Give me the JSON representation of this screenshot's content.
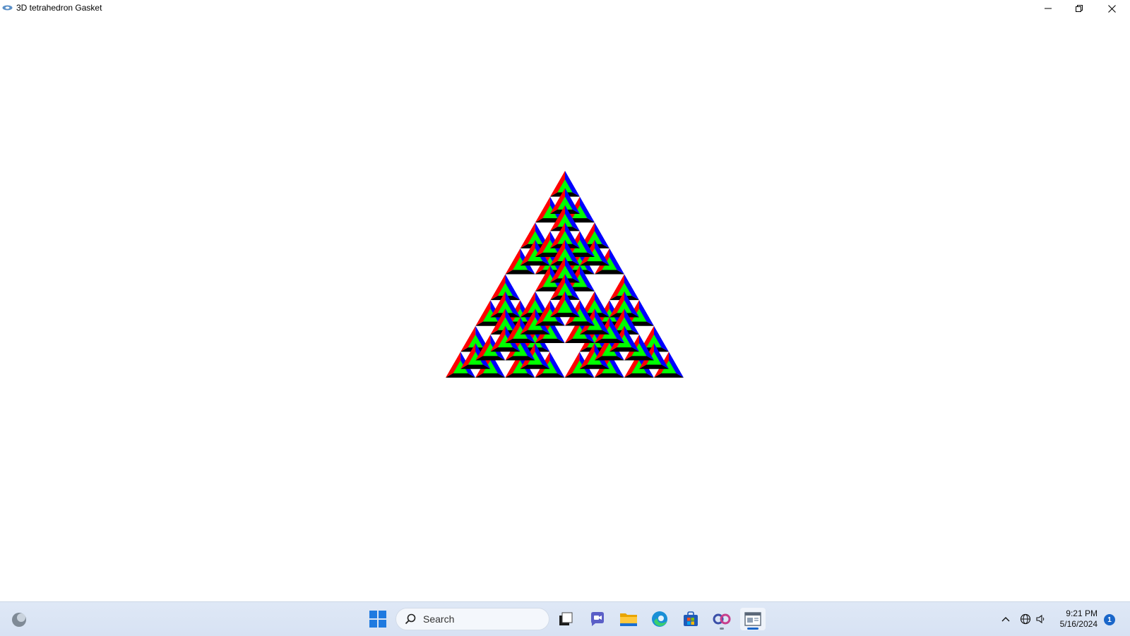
{
  "window": {
    "title": "3D tetrahedron Gasket",
    "controls": {
      "minimize": "minimize",
      "restore": "restore",
      "close": "close"
    }
  },
  "gasket": {
    "colors": {
      "left_face": "#ff0000",
      "right_face": "#0000ff",
      "inner_face": "#00ff00",
      "bottom_face": "#000000",
      "background": "#ffffff"
    }
  },
  "taskbar": {
    "search_placeholder": "Search",
    "pinned": [
      "widgets-icon",
      "start-icon",
      "task-view-icon",
      "chat-icon",
      "file-explorer-icon",
      "edge-icon",
      "store-icon",
      "app-icon",
      "gasket-window-icon"
    ],
    "clock": {
      "time": "9:21 PM",
      "date": "5/16/2024"
    },
    "notification_count": "1"
  }
}
